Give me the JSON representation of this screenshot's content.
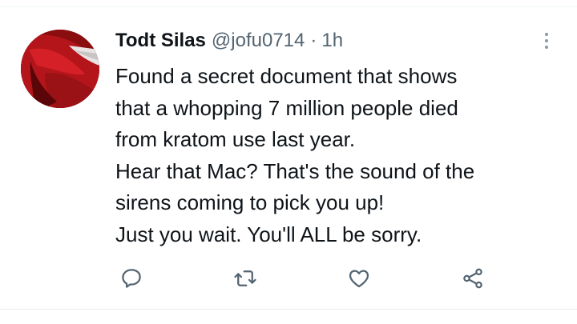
{
  "tweet": {
    "display_name": "Todt Silas",
    "handle": "@jofu0714",
    "separator": "·",
    "time": "1h",
    "lines": [
      "Found a secret document that shows",
      "that a whopping 7 million people died",
      "from kratom use last year.",
      "Hear that Mac? That's the sound of the",
      "sirens coming to pick you up!",
      "Just you wait. You'll ALL be sorry."
    ]
  },
  "icons": {
    "more": "more-vertical-icon",
    "reply": "reply-icon",
    "retweet": "retweet-icon",
    "like": "like-icon",
    "share": "share-icon"
  },
  "colors": {
    "text": "#0f1419",
    "secondary": "#536471",
    "icon": "#536471",
    "avatar": "#b3151a"
  }
}
